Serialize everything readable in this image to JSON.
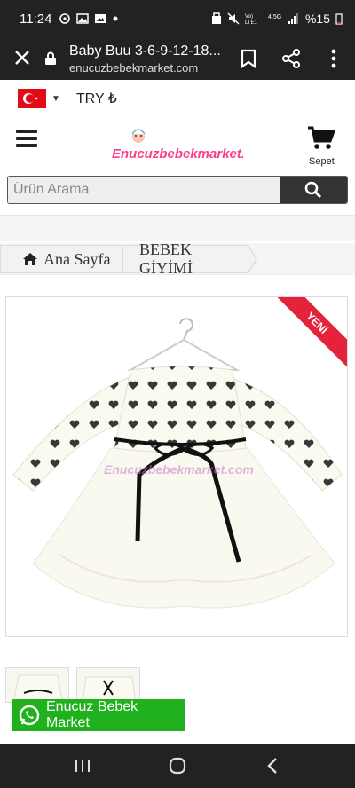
{
  "status_bar": {
    "time": "11:24",
    "battery": "%15"
  },
  "browser": {
    "page_title": "Baby Buu 3-6-9-12-18...",
    "url": "enucuzbebekmarket.com"
  },
  "currency": {
    "label": "TRY ₺"
  },
  "header": {
    "logo_text": "Enucuzbebekmarket.com",
    "cart_label": "Sepet"
  },
  "search": {
    "placeholder": "Ürün Arama"
  },
  "breadcrumb": {
    "items": [
      "Ana Sayfa",
      "BEBEK GİYİMİ"
    ]
  },
  "product": {
    "badge": "YENİ",
    "watermark": "Enucuzbebekmarket.com"
  },
  "whatsapp": {
    "label": "Enucuz Bebek Market"
  },
  "colors": {
    "whatsapp_green": "#21b11e",
    "badge_red": "#e4233a",
    "dark_bar": "#222222"
  }
}
